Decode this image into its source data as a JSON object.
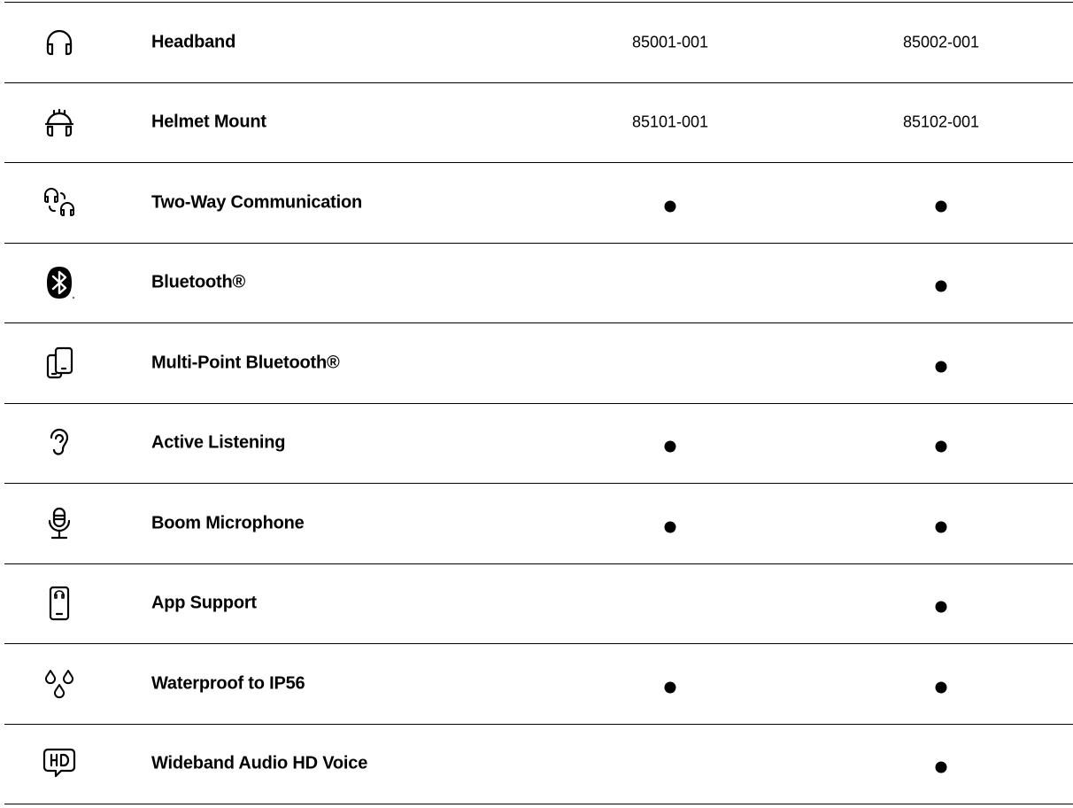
{
  "rows": [
    {
      "icon": "headphones-icon",
      "label": "Headband",
      "col1": "85001-001",
      "col2": "85002-001",
      "col1_dot": false,
      "col2_dot": false
    },
    {
      "icon": "helmet-headset-icon",
      "label": "Helmet Mount",
      "col1": "85101-001",
      "col2": "85102-001",
      "col1_dot": false,
      "col2_dot": false
    },
    {
      "icon": "two-way-headsets-icon",
      "label": "Two-Way Communication",
      "col1": "",
      "col2": "",
      "col1_dot": true,
      "col2_dot": true
    },
    {
      "icon": "bluetooth-icon",
      "label": "Bluetooth®",
      "col1": "",
      "col2": "",
      "col1_dot": false,
      "col2_dot": true
    },
    {
      "icon": "multi-device-icon",
      "label": "Multi-Point Bluetooth®",
      "col1": "",
      "col2": "",
      "col1_dot": false,
      "col2_dot": true
    },
    {
      "icon": "ear-icon",
      "label": "Active Listening",
      "col1": "",
      "col2": "",
      "col1_dot": true,
      "col2_dot": true
    },
    {
      "icon": "microphone-icon",
      "label": "Boom Microphone",
      "col1": "",
      "col2": "",
      "col1_dot": true,
      "col2_dot": true
    },
    {
      "icon": "phone-app-icon",
      "label": "App Support",
      "col1": "",
      "col2": "",
      "col1_dot": false,
      "col2_dot": true
    },
    {
      "icon": "water-drops-icon",
      "label": "Waterproof to IP56",
      "col1": "",
      "col2": "",
      "col1_dot": true,
      "col2_dot": true
    },
    {
      "icon": "hd-voice-icon",
      "label": "Wideband Audio HD Voice",
      "col1": "",
      "col2": "",
      "col1_dot": false,
      "col2_dot": true
    }
  ]
}
